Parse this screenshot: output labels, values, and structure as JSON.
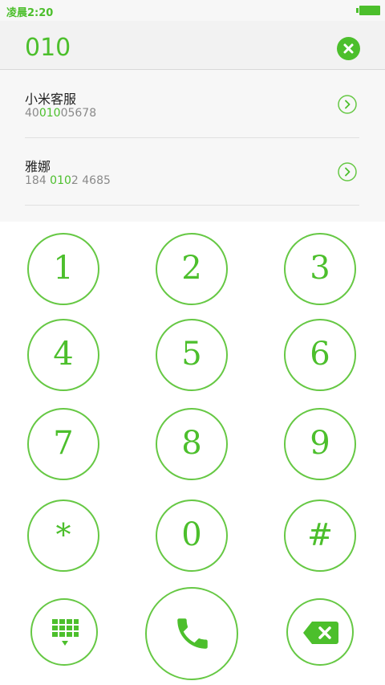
{
  "status_bar": {
    "time": "凌晨2:20"
  },
  "dialer": {
    "dialed_number": "010"
  },
  "results": [
    {
      "name": "小米客服",
      "number_parts": [
        "40",
        "010",
        "05678"
      ]
    },
    {
      "name": "雅娜",
      "number_parts": [
        "184 ",
        "010",
        "2 4685"
      ]
    }
  ],
  "keypad": {
    "keys": [
      "1",
      "2",
      "3",
      "4",
      "5",
      "6",
      "7",
      "8",
      "9",
      "*",
      "0",
      "#"
    ]
  },
  "bottom": {
    "keypad_toggle_icon": "dialpad-icon",
    "call_icon": "phone-icon",
    "backspace_icon": "backspace-icon"
  },
  "colors": {
    "accent": "#4cbf2c",
    "ring": "#66c844"
  }
}
